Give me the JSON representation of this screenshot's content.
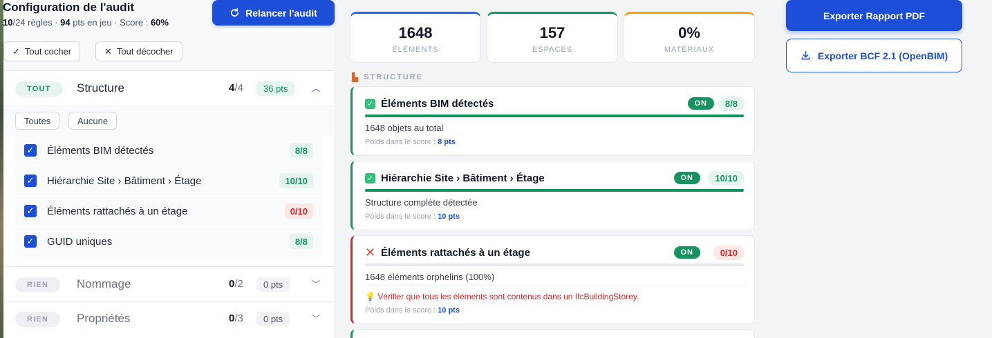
{
  "config": {
    "title": "Configuration de l'audit",
    "rules_active": "10",
    "rules_total_text": "/24 règles · ",
    "pts": "94",
    "pts_text": " pts en jeu · Score : ",
    "score": "60%",
    "rerun_label": "Relancer l'audit",
    "check_all_label": "Tout cocher",
    "uncheck_all_label": "Tout décocher"
  },
  "groups": [
    {
      "pill": "TOUT",
      "name": "Structure",
      "count_active": "4",
      "count_total": "/4",
      "pts": "36 pts",
      "select_all": "Toutes",
      "select_none": "Aucune",
      "rules": [
        {
          "label": "Éléments BIM détectés",
          "score": "8/8",
          "status": "ok"
        },
        {
          "label": "Hiérarchie Site › Bâtiment › Étage",
          "score": "10/10",
          "status": "ok"
        },
        {
          "label": "Éléments rattachés à un étage",
          "score": "0/10",
          "status": "bad"
        },
        {
          "label": "GUID uniques",
          "score": "8/8",
          "status": "ok"
        }
      ]
    },
    {
      "pill": "RIEN",
      "name": "Nommage",
      "count_active": "0",
      "count_total": "/2",
      "pts": "0 pts"
    },
    {
      "pill": "RIEN",
      "name": "Propriétés",
      "count_active": "0",
      "count_total": "/3",
      "pts": "0 pts"
    }
  ],
  "stats": [
    {
      "value": "1648",
      "label": "ÉLÉMENTS",
      "color": "#2563eb"
    },
    {
      "value": "157",
      "label": "ESPACES",
      "color": "#15935f"
    },
    {
      "value": "0%",
      "label": "MATÉRIAUX",
      "color": "#f59e0b"
    }
  ],
  "section": {
    "title": "STRUCTURE"
  },
  "cards": [
    {
      "title": "Éléments BIM détectés",
      "on": "ON",
      "score": "8/8",
      "progress": 1.0,
      "desc": "1648 objets au total",
      "weight_label": "Poids dans le score : ",
      "weight": "8 pts",
      "status": "ok"
    },
    {
      "title": "Hiérarchie Site › Bâtiment › Étage",
      "on": "ON",
      "score": "10/10",
      "progress": 1.0,
      "desc": "Structure complète détectée",
      "weight_label": "Poids dans le score : ",
      "weight": "10 pts",
      "status": "ok"
    },
    {
      "title": "Éléments rattachés à un étage",
      "on": "ON",
      "score": "0/10",
      "progress": 0.0,
      "desc": "1648 éléments orphelins (100%)",
      "hint": "Vérifier que tous les éléments sont contenus dans un IfcBuildingStorey.",
      "weight_label": "Poids dans le score : ",
      "weight": "10 pts",
      "status": "bad"
    }
  ],
  "export": {
    "pdf_label": "Exporter Rapport PDF",
    "bcf_label": "Exporter BCF 2.1 (OpenBIM)"
  }
}
